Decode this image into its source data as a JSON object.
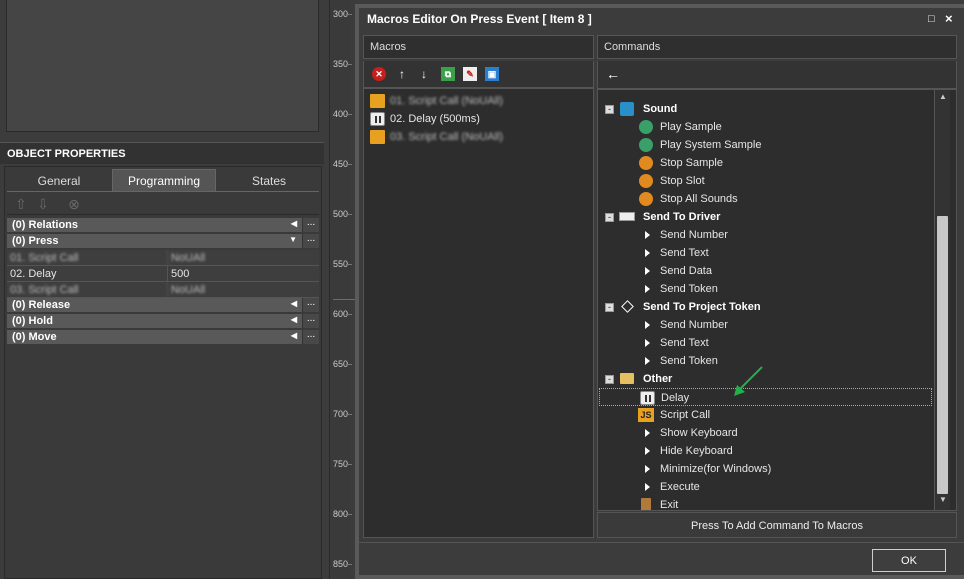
{
  "left_panel": {
    "object_properties_title": "OBJECT PROPERTIES",
    "tabs": [
      "General",
      "Programming",
      "States"
    ],
    "groups": [
      {
        "label": "(0) Relations"
      },
      {
        "label": "(0) Press"
      },
      {
        "label": "(0) Release"
      },
      {
        "label": "(0) Hold"
      },
      {
        "label": "(0) Move"
      }
    ],
    "press_rows": [
      {
        "key": "01. Script Call",
        "value": "NoUAll"
      },
      {
        "key": "02. Delay",
        "value": "500"
      },
      {
        "key": "03. Script Call",
        "value": "NoUAll"
      }
    ],
    "dots": "..."
  },
  "ruler": {
    "labels": [
      "300",
      "350",
      "400",
      "450",
      "500",
      "550",
      "600",
      "650",
      "700",
      "750",
      "800",
      "850"
    ]
  },
  "dialog": {
    "title": "Macros Editor On Press Event [ Item 8 ]",
    "macros_header": "Macros",
    "commands_header": "Commands",
    "macros": [
      {
        "label": "01. Script Call (NoUAll)",
        "blurred": true
      },
      {
        "label": "02. Delay (500ms)",
        "blurred": false
      },
      {
        "label": "03. Script Call (NoUAll)",
        "blurred": true
      }
    ],
    "tree": {
      "sound": {
        "label": "Sound",
        "items": [
          "Play Sample",
          "Play System Sample",
          "Stop Sample",
          "Stop Slot",
          "Stop All Sounds"
        ]
      },
      "send_to_driver": {
        "label": "Send To Driver",
        "items": [
          "Send Number",
          "Send Text",
          "Send Data",
          "Send Token"
        ]
      },
      "send_to_project_token": {
        "label": "Send To Project Token",
        "items": [
          "Send Number",
          "Send Text",
          "Send Token"
        ]
      },
      "other": {
        "label": "Other",
        "items": [
          "Delay",
          "Script Call",
          "Show Keyboard",
          "Hide Keyboard",
          "Minimize(for Windows)",
          "Execute",
          "Exit"
        ]
      }
    },
    "add_button": "Press To Add Command To Macros",
    "ok_button": "OK",
    "js_badge": "JS"
  },
  "colors": {
    "accent_green": "#22b04a",
    "orange": "#e8a020"
  }
}
